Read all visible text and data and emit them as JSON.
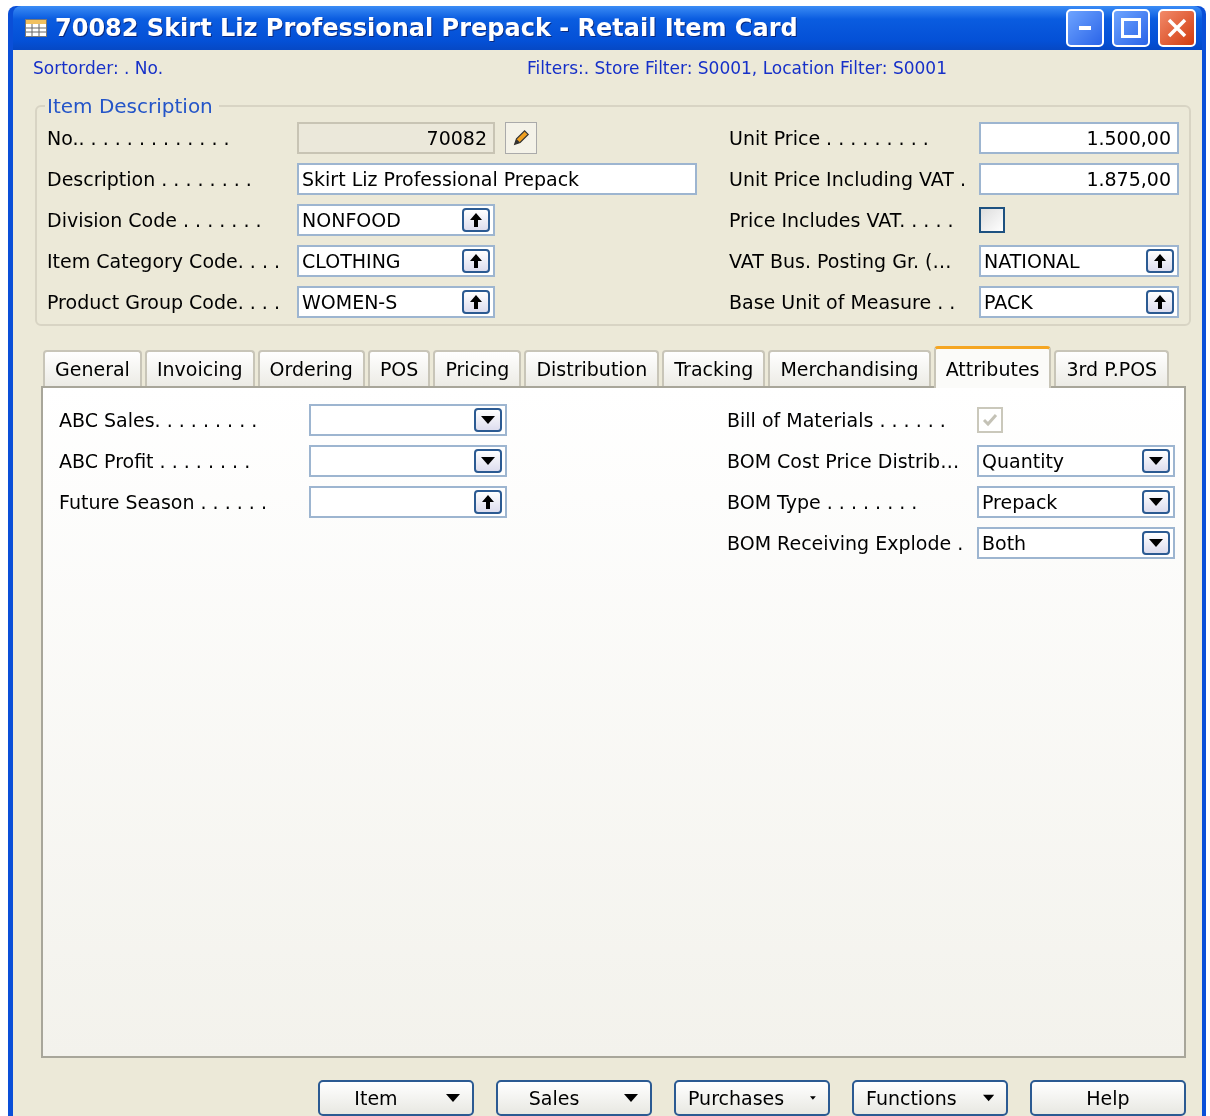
{
  "window": {
    "title": "70082 Skirt Liz Professional Prepack - Retail Item Card"
  },
  "info_bar": {
    "sort_order": "Sortorder: . No.",
    "filters": "Filters:. Store Filter: S0001, Location Filter: S0001"
  },
  "item_description": {
    "title": "Item Description",
    "left_fields": [
      {
        "label": "No.. . . . . . . . . . . . .",
        "kind": "readonly",
        "value": "70082"
      },
      {
        "label": "Description . . . . . . . .",
        "kind": "text_wide",
        "value": "Skirt Liz Professional Prepack"
      },
      {
        "label": "Division Code . . . . . . .",
        "kind": "lookup",
        "value": "NONFOOD"
      },
      {
        "label": "Item Category Code. . . .",
        "kind": "lookup",
        "value": "CLOTHING"
      },
      {
        "label": "Product Group Code. . . .",
        "kind": "lookup",
        "value": "WOMEN-S"
      }
    ],
    "right_fields": [
      {
        "label": "Unit Price . . . . . . . . .",
        "kind": "number",
        "value": "1.500,00"
      },
      {
        "label": "Unit Price Including VAT .",
        "kind": "number",
        "value": "1.875,00"
      },
      {
        "label": "Price Includes VAT. . . . .",
        "kind": "checkbox",
        "checked": false,
        "disabled": false
      },
      {
        "label": "VAT Bus. Posting Gr. (…",
        "kind": "lookup",
        "value": "NATIONAL"
      },
      {
        "label": "Base Unit of Measure . .",
        "kind": "lookup",
        "value": "PACK"
      }
    ]
  },
  "tabs": [
    {
      "label": "General",
      "selected": false
    },
    {
      "label": "Invoicing",
      "selected": false
    },
    {
      "label": "Ordering",
      "selected": false
    },
    {
      "label": "POS",
      "selected": false
    },
    {
      "label": "Pricing",
      "selected": false
    },
    {
      "label": "Distribution",
      "selected": false
    },
    {
      "label": "Tracking",
      "selected": false
    },
    {
      "label": "Merchandising",
      "selected": false
    },
    {
      "label": "Attributes",
      "selected": true
    },
    {
      "label": "3rd P.POS",
      "selected": false
    }
  ],
  "attributes": {
    "left_fields": [
      {
        "label": "ABC Sales. . . . . . . . .",
        "kind": "dropdown"
      },
      {
        "label": "ABC Profit . . . . . . . .",
        "kind": "dropdown"
      },
      {
        "label": "Future Season . . . . . .",
        "kind": "lookup"
      }
    ],
    "right_fields": [
      {
        "label": "Bill of Materials . . . . . .",
        "kind": "checkbox",
        "checked": true,
        "disabled": true
      },
      {
        "label": "BOM Cost Price Distrib…",
        "kind": "dropdown",
        "value": "Quantity"
      },
      {
        "label": "BOM Type . . . . . . . .",
        "kind": "dropdown",
        "value": "Prepack"
      },
      {
        "label": "BOM Receiving Explode .",
        "kind": "dropdown",
        "value": "Both"
      }
    ]
  },
  "buttons": [
    {
      "label": "Item",
      "kind": "menu"
    },
    {
      "label": "Sales",
      "kind": "menu"
    },
    {
      "label": "Purchases",
      "kind": "menu"
    },
    {
      "label": "Functions",
      "kind": "menu"
    },
    {
      "label": "Help",
      "kind": "plain"
    }
  ]
}
